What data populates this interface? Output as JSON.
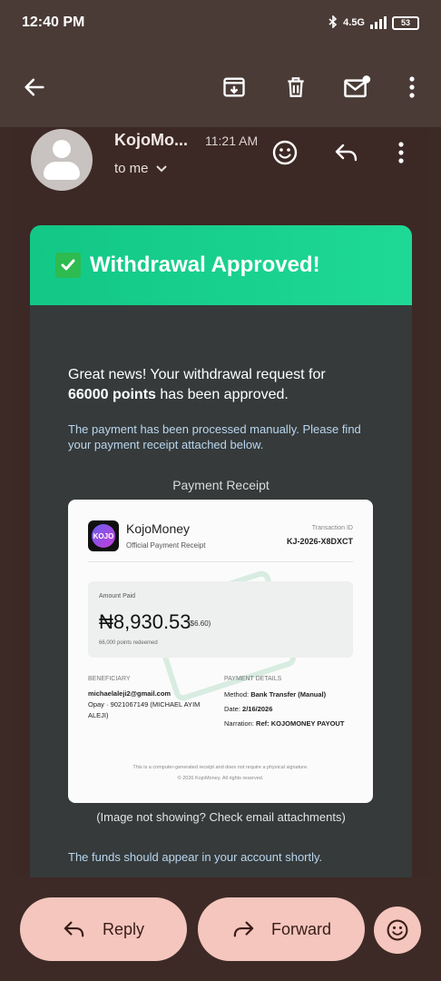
{
  "status_bar": {
    "time": "12:40 PM",
    "network": "4.5G",
    "battery": "53"
  },
  "toolbar": {
    "back_icon": "arrow-left-icon",
    "archive_icon": "archive-icon",
    "delete_icon": "trash-icon",
    "mark_unread_icon": "mail-unread-icon",
    "more_icon": "more-vert-icon"
  },
  "email": {
    "sender": "KojoMo...",
    "time": "11:21 AM",
    "recipient": "to me"
  },
  "card": {
    "title": "Withdrawal Approved!",
    "intro_prefix": "Great news! Your withdrawal request for",
    "intro_points": "66000 points",
    "intro_suffix": "has been approved.",
    "processed_note": "The payment has been processed manually. Please find your payment receipt attached below.",
    "receipt_heading": "Payment Receipt",
    "image_note": "(Image not showing? Check email attachments)",
    "closing": "The funds should appear in your account shortly."
  },
  "receipt": {
    "logo_text": "KOJO",
    "brand": "KojoMoney",
    "brand_sub": "Official Payment Receipt",
    "watermark": "PAID",
    "transaction_label": "Transaction ID",
    "transaction_id": "KJ-2026-X8DXCT",
    "amount_label": "Amount Paid",
    "amount": "₦8,930.53",
    "amount_usd": "($6.60)",
    "points_redeemed": "66,000 points redeemed",
    "beneficiary_label": "BENEFICIARY",
    "beneficiary_email": "michaelaleji2@gmail.com",
    "beneficiary_account": "Opay · 9021067149 (MICHAEL AYIM ALEJI)",
    "details_label": "PAYMENT DETAILS",
    "method_label": "Method:",
    "method_value": "Bank Transfer (Manual)",
    "date_label": "Date:",
    "date_value": "2/16/2026",
    "narration_label": "Narration:",
    "narration_value": "Ref: KOJOMONEY PAYOUT",
    "footer_line1": "This is a computer-generated receipt and does not require a physical signature.",
    "footer_line2": "© 2026 KojoMoney. All rights reserved."
  },
  "actions": {
    "reply_label": "Reply",
    "forward_label": "Forward"
  },
  "colors": {
    "header_green": "#1ed996",
    "card_bg": "#363a3a",
    "accent_pink": "#f4c6bd"
  }
}
